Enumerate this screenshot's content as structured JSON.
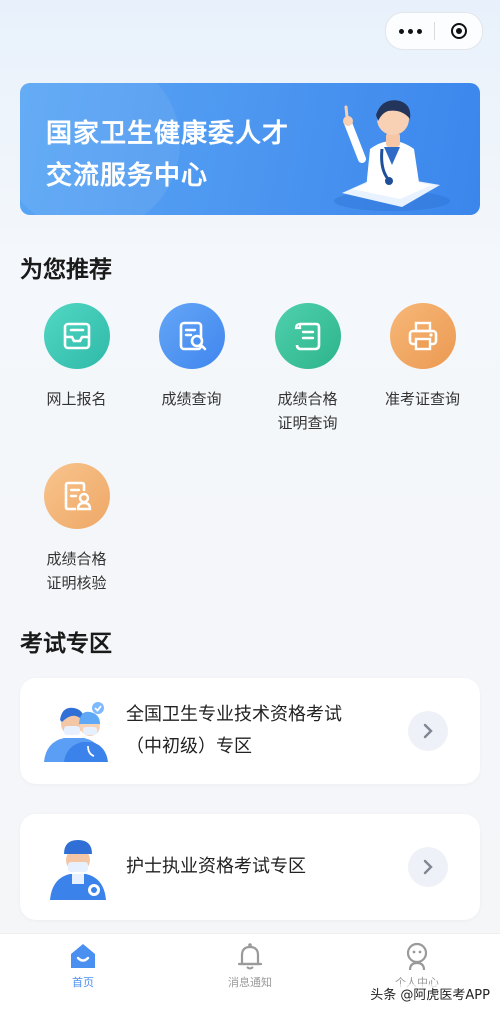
{
  "banner": {
    "line1": "国家卫生健康委人才",
    "line2": "交流服务中心"
  },
  "recommend": {
    "title": "为您推荐",
    "items": [
      {
        "label": "网上报名",
        "icon": "registration-icon",
        "color": "#3cc8b4"
      },
      {
        "label": "成绩查询",
        "icon": "score-search-icon",
        "color": "#4a90f0"
      },
      {
        "label": "成绩合格\n证明查询",
        "icon": "certificate-scroll-icon",
        "color": "#3cbf9a"
      },
      {
        "label": "准考证查询",
        "icon": "printer-icon",
        "color": "#f0a866"
      },
      {
        "label": "成绩合格\n证明核验",
        "icon": "certificate-verify-icon",
        "color": "#f0b677"
      }
    ]
  },
  "exam": {
    "title": "考试专区",
    "cards": [
      {
        "label": "全国卫生专业技术资格考试（中初级）专区",
        "icon": "doctors-icon"
      },
      {
        "label": "护士执业资格考试专区",
        "icon": "nurse-icon"
      }
    ]
  },
  "tabbar": {
    "items": [
      {
        "label": "首页",
        "icon": "home-icon",
        "active": true
      },
      {
        "label": "消息通知",
        "icon": "bell-icon",
        "active": false
      },
      {
        "label": "个人中心",
        "icon": "person-icon",
        "active": false
      }
    ],
    "active_color": "#4a90f0",
    "inactive_color": "#9a9a9a"
  },
  "watermark": "头条 @阿虎医考APP"
}
